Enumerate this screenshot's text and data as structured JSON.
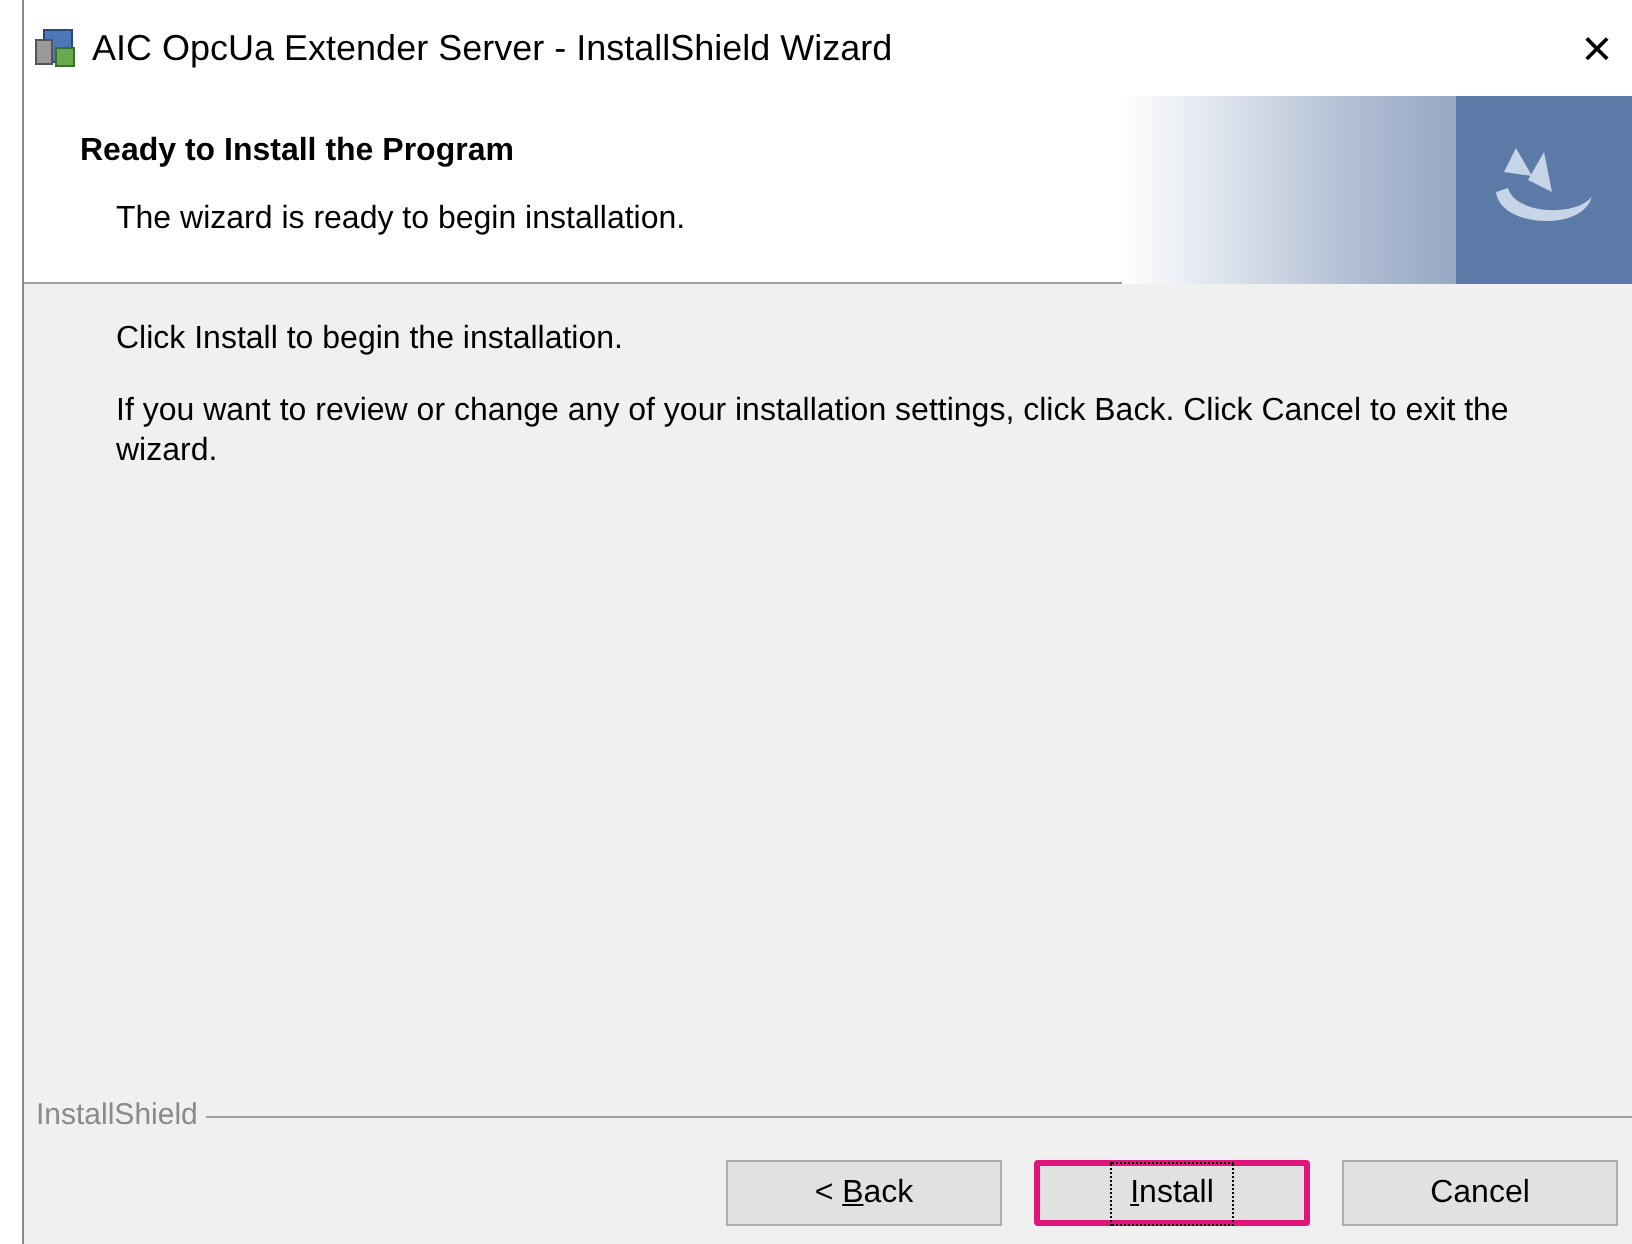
{
  "window": {
    "title": "AIC OpcUa Extender Server - InstallShield Wizard",
    "close": "×"
  },
  "header": {
    "title": "Ready to Install the Program",
    "subtitle": "The wizard is ready to begin installation."
  },
  "body": {
    "paragraphs": [
      "Click Install to begin the installation.",
      "If you want to review or change any of your installation settings, click Back. Click Cancel to exit the wizard."
    ]
  },
  "footer": {
    "brand": "InstallShield"
  },
  "buttons": [
    {
      "label_start": "< ",
      "mnemonic": "B",
      "label_end": "ack",
      "focused": false,
      "highlighted": false
    },
    {
      "mnemonic": "I",
      "label_end": "nstall",
      "focused": true,
      "highlighted": true
    },
    {
      "label_start": "Cancel",
      "focused": false,
      "highlighted": false
    }
  ]
}
